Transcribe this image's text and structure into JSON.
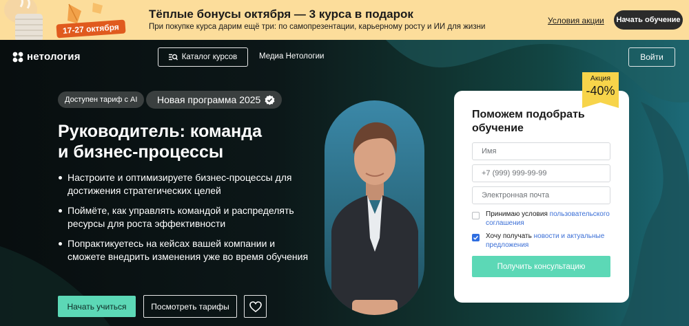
{
  "promo": {
    "dates": "17-27 октября",
    "title": "Тёплые бонусы октября — 3 курса в подарок",
    "subtitle": "При покупке курса дарим ещё три: по самопрезентации, карьерному росту и ИИ для жизни",
    "terms_link": "Условия акции",
    "cta": "Начать обучение"
  },
  "nav": {
    "logo": "нетология",
    "catalog": "Каталог курсов",
    "media": "Медиа Нетологии",
    "login": "Войти"
  },
  "hero": {
    "badge_ai": "Доступен тариф с AI",
    "badge_new": "Новая программа 2025",
    "title_line1": "Руководитель: команда",
    "title_line2": "и бизнес-процессы",
    "bullets": [
      "Настроите и оптимизируете бизнес-процессы для достижения стратегических целей",
      "Поймёте, как управлять командой и распределять ресурсы для роста эффективности",
      "Попрактикуетесь на кейсах вашей компании и сможете внедрить изменения уже во время обучения"
    ],
    "start_button": "Начать учиться",
    "tariffs_button": "Посмотреть тарифы"
  },
  "form": {
    "title": "Поможем подобрать обучение",
    "name_placeholder": "Имя",
    "phone_placeholder": "+7 (999) 999-99-99",
    "email_placeholder": "Электронная почта",
    "consent_text": "Принимаю условия ",
    "consent_link": "пользовательского соглашения",
    "consent_checked": false,
    "news_text": "Хочу получать ",
    "news_link": "новости и актуальные предложения",
    "news_checked": true,
    "submit": "Получить консультацию"
  },
  "sale": {
    "label": "Акция",
    "value": "-40%"
  },
  "colors": {
    "banner": "#fcdd9b",
    "accent_green": "#5cd8b6",
    "sale_yellow": "#f7d44a",
    "link_blue": "#3b6fd6"
  }
}
